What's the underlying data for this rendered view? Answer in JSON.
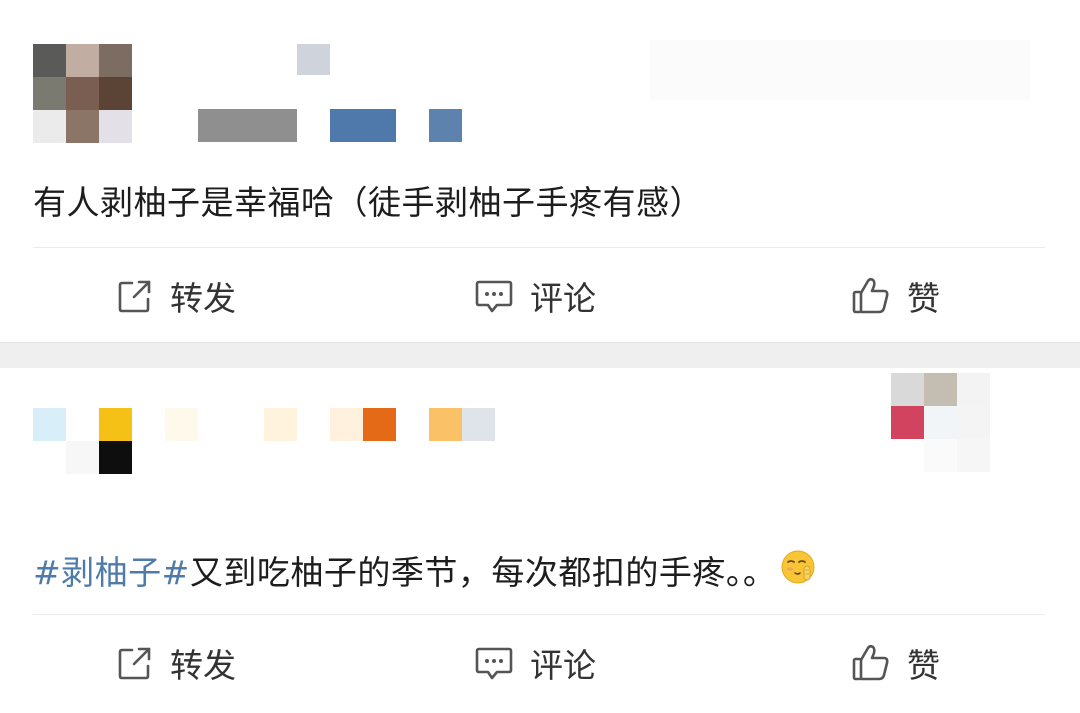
{
  "colors": {
    "topic_link": "#4f7bab",
    "body_text": "#1d1d1d",
    "action_text": "#333333",
    "separator": "#efefef"
  },
  "posts": [
    {
      "text": "有人剥柚子是幸福哈（徒手剥柚子手疼有感）",
      "topic": "",
      "emoji": "",
      "actions": {
        "repost": {
          "label": "转发",
          "icon": "share-icon"
        },
        "comment": {
          "label": "评论",
          "icon": "comment-icon"
        },
        "like": {
          "label": "赞",
          "icon": "thumbs-up-icon"
        }
      }
    },
    {
      "topic": "#剥柚子#",
      "text": "又到吃柚子的季节，每次都扣的手疼。。",
      "emoji": "shy-face-emoji",
      "actions": {
        "repost": {
          "label": "转发",
          "icon": "share-icon"
        },
        "comment": {
          "label": "评论",
          "icon": "comment-icon"
        },
        "like": {
          "label": "赞",
          "icon": "thumbs-up-icon"
        }
      }
    }
  ]
}
